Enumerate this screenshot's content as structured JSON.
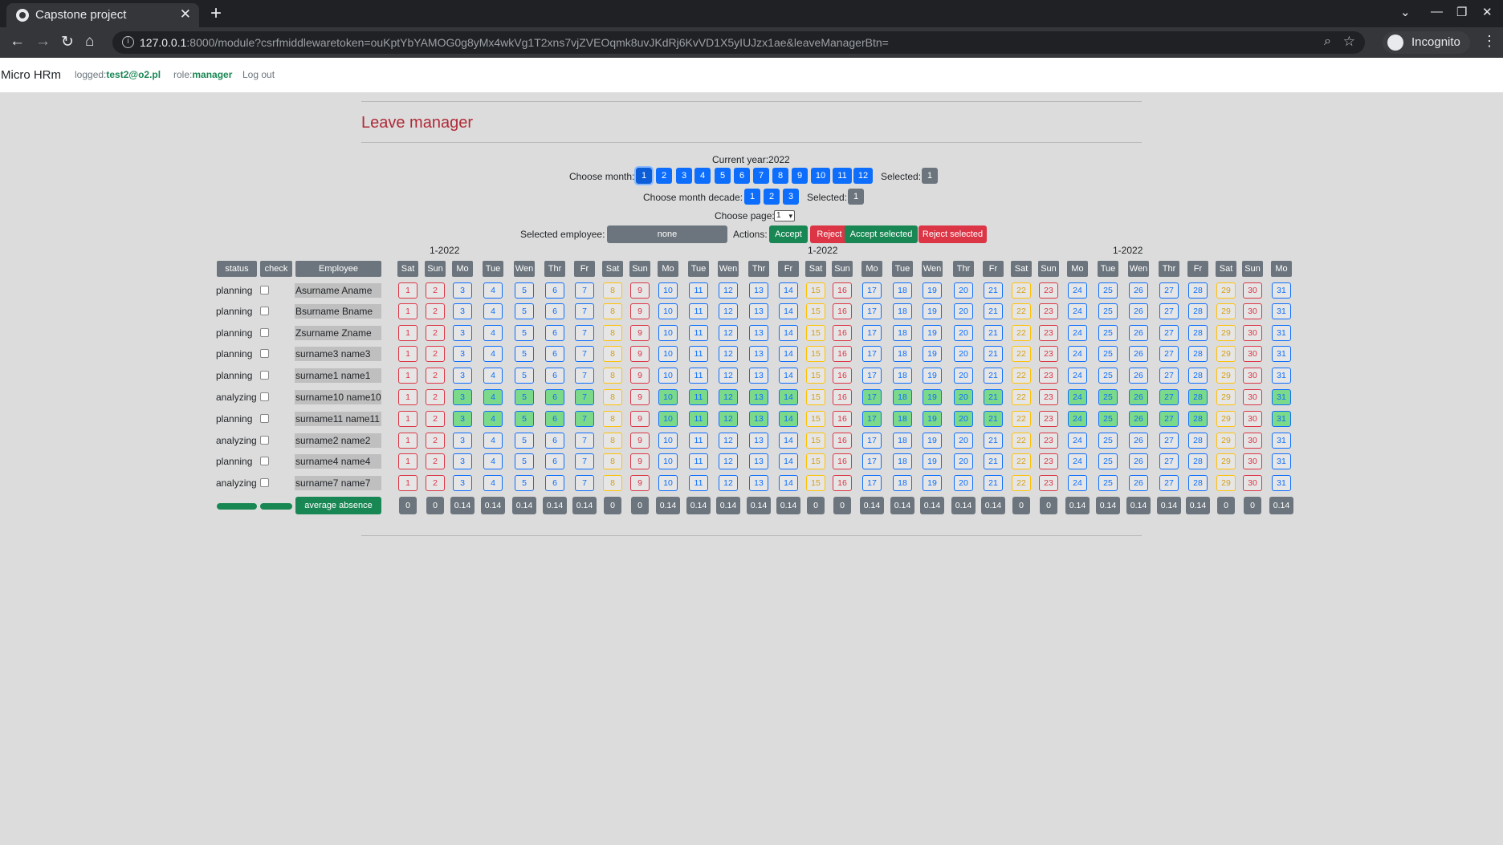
{
  "browser": {
    "tab_title": "Capstone project",
    "url_host": "127.0.0.1",
    "url_rest": ":8000/module?csrfmiddlewaretoken=ouKptYbYAMOG0g8yMx4wkVg1T2xns7vjZVEOqmk8uvJKdRj6KvVD1X5yIUJzx1ae&leaveManagerBtn=",
    "profile": "Incognito"
  },
  "app": {
    "brand": "Micro HRm",
    "logged_label": "logged:",
    "logged_user": "test2@o2.pl",
    "role_label": "role:",
    "role": "manager",
    "logout": "Log out"
  },
  "page": {
    "title": "Leave manager"
  },
  "controls": {
    "current_year": "Current year:2022",
    "choose_month_label": "Choose month:",
    "months": [
      "1",
      "2",
      "3",
      "4",
      "5",
      "6",
      "7",
      "8",
      "9",
      "10",
      "11",
      "12"
    ],
    "active_month": "1",
    "selected_label": "Selected:",
    "selected_month": "1",
    "choose_decade_label": "Choose month decade:",
    "decades": [
      "1",
      "2",
      "3"
    ],
    "selected_decade": "1",
    "choose_page_label": "Choose page:",
    "page_value": "1",
    "selected_employee_label": "Selected employee:",
    "selected_employee": "none",
    "actions_label": "Actions:",
    "actions": [
      {
        "label": "Accept",
        "color": "#198754"
      },
      {
        "label": "Reject",
        "color": "#dc3545"
      },
      {
        "label": "Accept selected",
        "color": "#198754"
      },
      {
        "label": "Reject selected",
        "color": "#dc3545"
      }
    ]
  },
  "calendar": {
    "period_labels": [
      "1-2022",
      "1-2022",
      "1-2022"
    ],
    "headers": {
      "status": "status",
      "check": "check",
      "employee": "Employee"
    },
    "day_names": [
      "Sat",
      "Sun",
      "Mo",
      "Tue",
      "Wen",
      "Thr",
      "Fr",
      "Sat",
      "Sun",
      "Mo",
      "Tue",
      "Wen",
      "Thr",
      "Fr",
      "Sat",
      "Sun",
      "Mo",
      "Tue",
      "Wen",
      "Thr",
      "Fr",
      "Sat",
      "Sun",
      "Mo",
      "Tue",
      "Wen",
      "Thr",
      "Fr",
      "Sat",
      "Sun",
      "Mo"
    ],
    "day_kind": [
      "red",
      "red",
      "blue",
      "blue",
      "blue",
      "blue",
      "blue",
      "yel",
      "red",
      "blue",
      "blue",
      "blue",
      "blue",
      "blue",
      "yel",
      "red",
      "blue",
      "blue",
      "blue",
      "blue",
      "blue",
      "yel",
      "red",
      "blue",
      "blue",
      "blue",
      "blue",
      "blue",
      "yel",
      "red",
      "blue"
    ],
    "rows": [
      {
        "status": "planning",
        "name": "Asurname Aname",
        "leave": false
      },
      {
        "status": "planning",
        "name": "Bsurname Bname",
        "leave": false
      },
      {
        "status": "planning",
        "name": "Zsurname Zname",
        "leave": false
      },
      {
        "status": "planning",
        "name": "surname3 name3",
        "leave": false
      },
      {
        "status": "planning",
        "name": "surname1 name1",
        "leave": false
      },
      {
        "status": "analyzing",
        "name": "surname10 name10",
        "leave": true
      },
      {
        "status": "planning",
        "name": "surname11 name11",
        "leave": true
      },
      {
        "status": "analyzing",
        "name": "surname2 name2",
        "leave": false
      },
      {
        "status": "planning",
        "name": "surname4 name4",
        "leave": false
      },
      {
        "status": "analyzing",
        "name": "surname7 name7",
        "leave": false
      }
    ],
    "average_label": "average absence",
    "average_absence": [
      "0",
      "0",
      "0.14",
      "0.14",
      "0.14",
      "0.14",
      "0.14",
      "0",
      "0",
      "0.14",
      "0.14",
      "0.14",
      "0.14",
      "0.14",
      "0",
      "0",
      "0.14",
      "0.14",
      "0.14",
      "0.14",
      "0.14",
      "0",
      "0",
      "0.14",
      "0.14",
      "0.14",
      "0.14",
      "0.14",
      "0",
      "0",
      "0.14"
    ]
  }
}
